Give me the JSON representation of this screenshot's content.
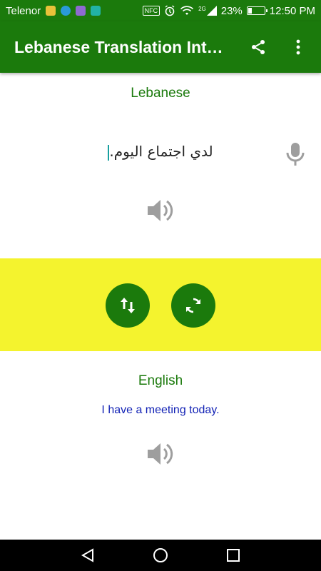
{
  "status_bar": {
    "carrier": "Telenor",
    "network": "2G",
    "battery": "23%",
    "battery_level": 0.23,
    "time": "12:50 PM",
    "nfc": "NFC"
  },
  "app_bar": {
    "title": "Lebanese Translation Int…",
    "share_icon": "share-icon",
    "menu_icon": "more-vert-icon"
  },
  "source": {
    "language": "Lebanese",
    "text": "لدي اجتماع اليوم.",
    "mic_icon": "mic-icon",
    "speaker_icon": "speaker-icon"
  },
  "controls": {
    "swap_icon": "swap-vertical-icon",
    "refresh_icon": "refresh-icon"
  },
  "target": {
    "language": "English",
    "text": "I have a meeting today.",
    "speaker_icon": "speaker-icon"
  },
  "colors": {
    "primary": "#1b7a0c",
    "band": "#f4f32e",
    "translated_text": "#1222b5"
  }
}
